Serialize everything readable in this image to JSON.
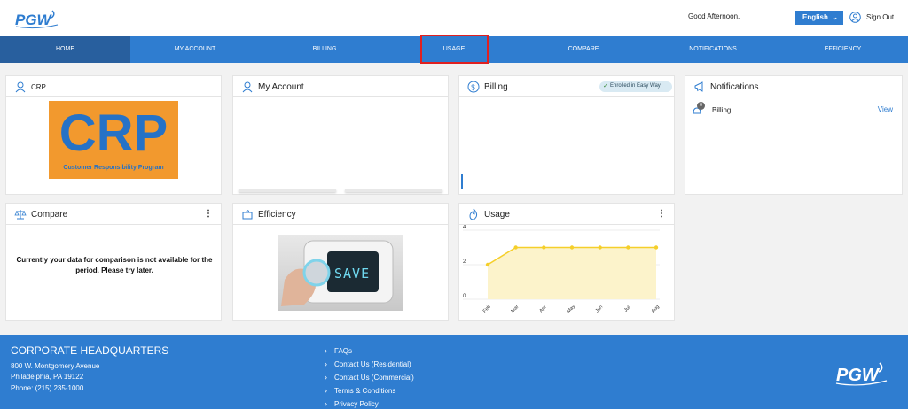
{
  "header": {
    "greeting": "Good Afternoon,",
    "language": "English",
    "signout": "Sign Out"
  },
  "nav": {
    "items": [
      "HOME",
      "MY ACCOUNT",
      "BILLING",
      "USAGE",
      "COMPARE",
      "NOTIFICATIONS",
      "EFFICIENCY"
    ],
    "active": "HOME",
    "highlighted": "USAGE"
  },
  "cards": {
    "crp": {
      "title": "CRP",
      "banner_big": "CRP",
      "banner_sub": "Customer Responsibility Program"
    },
    "my_account": {
      "title": "My Account"
    },
    "billing": {
      "title": "Billing",
      "badge": "Enrolled in Easy Way"
    },
    "notifications": {
      "title": "Notifications",
      "row_label": "Billing",
      "row_count": "0",
      "row_action": "View"
    },
    "compare": {
      "title": "Compare",
      "message": "Currently your data for comparison is not available for the period. Please try later."
    },
    "efficiency": {
      "title": "Efficiency",
      "display_text": "SAVE"
    },
    "usage": {
      "title": "Usage"
    }
  },
  "chart_data": {
    "type": "area",
    "categories": [
      "Feb",
      "Mar",
      "Apr",
      "May",
      "Jun",
      "Jul",
      "Aug"
    ],
    "series": [
      {
        "values": [
          2,
          3,
          3,
          3,
          3,
          3,
          3
        ]
      }
    ],
    "ylim": [
      0,
      4
    ],
    "yticks": [
      "4",
      "2",
      "0"
    ],
    "grid": true,
    "color": "#f5cf2a",
    "fill": "#fcf3cb"
  },
  "footer": {
    "hq_title": "CORPORATE HEADQUARTERS",
    "address1": "800 W. Montgomery Avenue",
    "address2": "Philadelphia, PA 19122",
    "phone": "Phone: (215) 235-1000",
    "links": [
      "FAQs",
      "Contact Us (Residential)",
      "Contact Us (Commercial)",
      "Terms & Conditions",
      "Privacy Policy"
    ]
  },
  "colors": {
    "brand_blue": "#2f7dd0",
    "nav_active": "#285f9e",
    "highlight": "#e02020",
    "crp_orange": "#f2992e"
  }
}
